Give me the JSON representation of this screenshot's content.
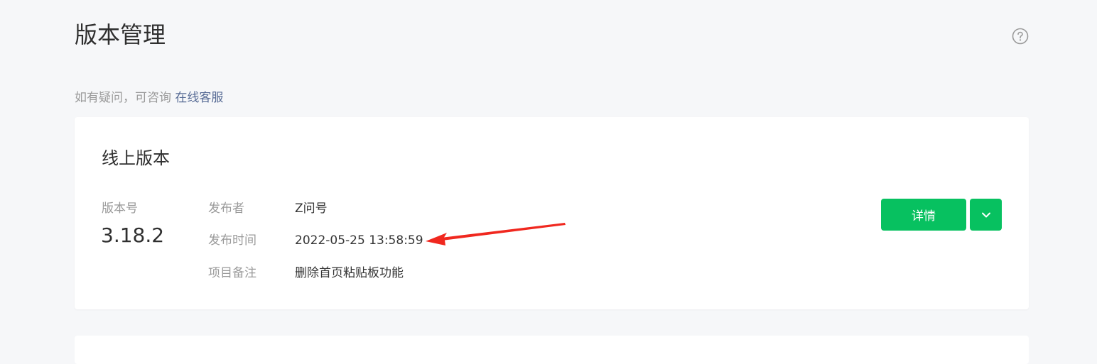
{
  "page": {
    "title": "版本管理"
  },
  "notice": {
    "text": "如有疑问，可咨询 ",
    "link_label": "在线客服"
  },
  "online_version": {
    "title": "线上版本",
    "version_label": "版本号",
    "version_number": "3.18.2",
    "fields": [
      {
        "label": "发布者",
        "value": "Z问号"
      },
      {
        "label": "发布时间",
        "value": "2022-05-25 13:58:59"
      },
      {
        "label": "项目备注",
        "value": "删除首页粘贴板功能"
      }
    ],
    "detail_button_label": "详情"
  },
  "colors": {
    "accent_green": "#07c160",
    "link_blue": "#576b95",
    "annotation_red": "#f0281f"
  },
  "icons": {
    "help": "question-circle-icon",
    "dropdown": "chevron-down-icon",
    "annotation": "red-arrow-annotation"
  }
}
